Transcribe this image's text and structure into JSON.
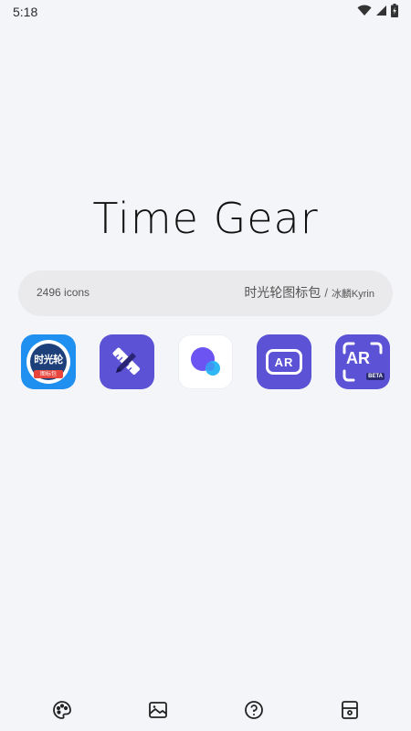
{
  "status_bar": {
    "time": "5:18",
    "icons": [
      "wifi-icon",
      "cell-signal-icon",
      "battery-charging-icon"
    ]
  },
  "app": {
    "title": "Time Gear"
  },
  "info_bar": {
    "icon_count": "2496 icons",
    "pack_name": "时光轮图标包",
    "separator": "/",
    "author": "冰麟Kyrin"
  },
  "preview_icons": [
    {
      "name": "shiguanglun-icon",
      "label": "时光轮",
      "sublabel": "图标包"
    },
    {
      "name": "ruler-pencil-icon"
    },
    {
      "name": "circle-bubble-icon"
    },
    {
      "name": "ar-glasses-icon",
      "label": "AR"
    },
    {
      "name": "ar-beta-icon",
      "label": "AR",
      "badge": "BETA"
    }
  ],
  "bottom_nav": [
    {
      "icon": "palette-icon"
    },
    {
      "icon": "wallpaper-icon"
    },
    {
      "icon": "help-icon"
    },
    {
      "icon": "widget-icon"
    }
  ],
  "colors": {
    "background": "#f4f5f9",
    "info_bar": "#eaeaec",
    "purple_accent": "#5b52d6",
    "blue_accent": "#1f8ff0"
  }
}
